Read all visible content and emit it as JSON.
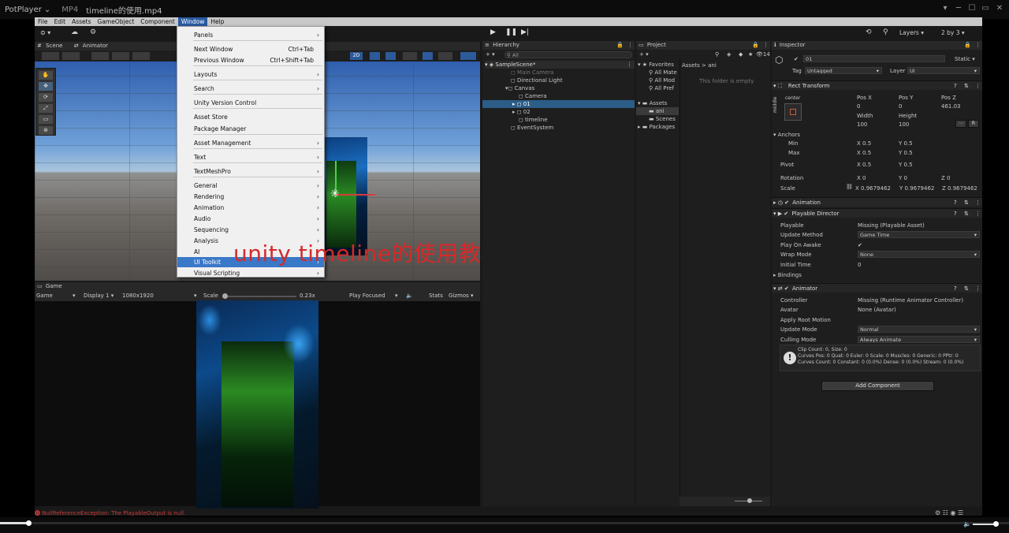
{
  "player": {
    "app": "PotPlayer",
    "format": "MP4",
    "file": "timeline的使用.mp4",
    "error": "NullReferenceException: The PlayableOutput is null."
  },
  "menubar": [
    "File",
    "Edit",
    "Assets",
    "GameObject",
    "Component",
    "Window",
    "Help"
  ],
  "toolbar": {
    "layers": "Layers",
    "layout": "2 by 3"
  },
  "scene_tabs": {
    "scene": "Scene",
    "animator": "Animator"
  },
  "window_menu": {
    "items": [
      {
        "label": "Panels",
        "arrow": true
      },
      {
        "label": "Next Window",
        "shortcut": "Ctrl+Tab"
      },
      {
        "label": "Previous Window",
        "shortcut": "Ctrl+Shift+Tab"
      },
      {
        "label": "Layouts",
        "arrow": true
      },
      {
        "label": "Search",
        "arrow": true
      },
      {
        "label": "Unity Version Control"
      },
      {
        "label": "Asset Store"
      },
      {
        "label": "Package Manager"
      },
      {
        "label": "Asset Management",
        "arrow": true
      },
      {
        "label": "Text",
        "arrow": true
      },
      {
        "label": "TextMeshPro",
        "arrow": true
      },
      {
        "label": "General",
        "arrow": true
      },
      {
        "label": "Rendering",
        "arrow": true
      },
      {
        "label": "Animation",
        "arrow": true
      },
      {
        "label": "Audio",
        "arrow": true
      },
      {
        "label": "Sequencing",
        "arrow": true
      },
      {
        "label": "Analysis",
        "arrow": true
      },
      {
        "label": "AI",
        "arrow": true
      },
      {
        "label": "UI Toolkit",
        "arrow": true
      },
      {
        "label": "Visual Scripting",
        "arrow": true
      }
    ]
  },
  "overlay_title": "unity timeline的使用教程",
  "game": {
    "tab": "Game",
    "mode": "Game",
    "display": "Display 1",
    "resolution": "1080x1920",
    "scale_label": "Scale",
    "scale_value": "0.23x",
    "play": "Play Focused",
    "stats": "Stats",
    "gizmos": "Gizmos"
  },
  "hierarchy": {
    "tab": "Hierarchy",
    "search": "All",
    "items": [
      "SampleScene*",
      "Main Camera",
      "Directional Light",
      "Canvas",
      "Camera",
      "01",
      "02",
      "timeline",
      "EventSystem"
    ]
  },
  "project": {
    "tab": "Project",
    "favorites": "Favorites",
    "fav_items": [
      "All Mate",
      "All Mod",
      "All Pref"
    ],
    "assets": "Assets",
    "asset_items": [
      "ani",
      "Scenes"
    ],
    "packages": "Packages",
    "path": "Assets > ani",
    "empty": "This folder is empty",
    "count": "14"
  },
  "inspector": {
    "tab": "Inspector",
    "name": "01",
    "static": "Static",
    "tag_label": "Tag",
    "tag": "Untagged",
    "layer_label": "Layer",
    "layer": "UI",
    "rect_transform": "Rect Transform",
    "anchor_h": "center",
    "anchor_v": "middle",
    "pos_labels": [
      "Pos X",
      "Pos Y",
      "Pos Z"
    ],
    "pos_values": [
      "0",
      "0",
      "461.03"
    ],
    "size_labels": [
      "Width",
      "Height"
    ],
    "size_values": [
      "100",
      "100"
    ],
    "anchors": "Anchors",
    "min": "Min",
    "max": "Max",
    "min_x": "X 0.5",
    "min_y": "Y 0.5",
    "max_x": "X 0.5",
    "max_y": "Y 0.5",
    "pivot": "Pivot",
    "pivot_x": "X 0.5",
    "pivot_y": "Y 0.5",
    "rotation": "Rotation",
    "rot_x": "X 0",
    "rot_y": "Y 0",
    "rot_z": "Z 0",
    "scale": "Scale",
    "scale_x": "X 0.9679462",
    "scale_y": "Y 0.9679462",
    "scale_z": "Z 0.9679462",
    "animation": "Animation",
    "playable_director": "Playable Director",
    "pd_fields": [
      {
        "label": "Playable",
        "value": "Missing (Playable Asset)"
      },
      {
        "label": "Update Method",
        "value": "Game Time"
      },
      {
        "label": "Play On Awake",
        "value": "✔"
      },
      {
        "label": "Wrap Mode",
        "value": "None"
      },
      {
        "label": "Initial Time",
        "value": "0"
      }
    ],
    "bindings": "Bindings",
    "animator": "Animator",
    "an_fields": [
      {
        "label": "Controller",
        "value": "Missing (Runtime Animator Controller)"
      },
      {
        "label": "Avatar",
        "value": "None (Avatar)"
      },
      {
        "label": "Apply Root Motion",
        "value": ""
      },
      {
        "label": "Update Mode",
        "value": "Normal"
      },
      {
        "label": "Culling Mode",
        "value": "Always Animate"
      }
    ],
    "info_lines": [
      "Clip Count: 0, Size: 0",
      "Curves Pos: 0 Quat: 0 Euler: 0 Scale: 0 Muscles: 0 Generic: 0 PPtr: 0",
      "Curves Count: 0 Constant: 0 (0.0%) Dense: 0 (0.0%) Stream: 0 (0.0%)"
    ],
    "add_component": "Add Component"
  }
}
